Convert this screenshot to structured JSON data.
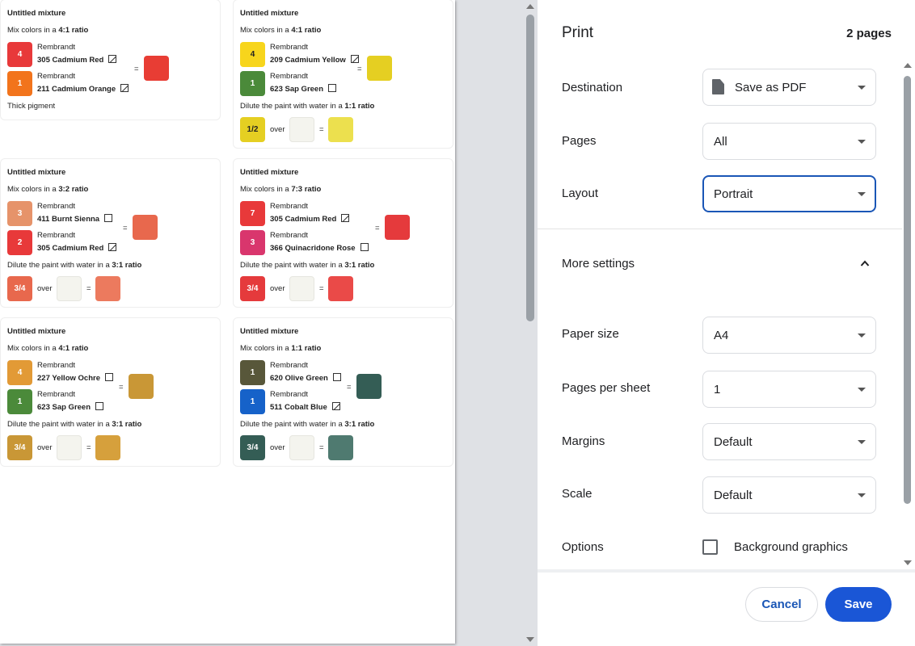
{
  "preview": {
    "cards": [
      {
        "title": "Untitled mixture",
        "mix_prefix": "Mix colors in a ",
        "ratio": "4:1 ratio",
        "paints": [
          {
            "count": "4",
            "brand": "Rembrandt",
            "name": "305 Cadmium Red",
            "color": "#e8393a",
            "flag": "half"
          },
          {
            "count": "1",
            "brand": "Rembrandt",
            "name": "211 Cadmium Orange",
            "color": "#f2741c",
            "flag": "half"
          }
        ],
        "equals": "=",
        "result_color": "#e83d34",
        "note": "Thick pigment"
      },
      {
        "title": "Untitled mixture",
        "mix_prefix": "Mix colors in a ",
        "ratio": "4:1 ratio",
        "paints": [
          {
            "count": "4",
            "brand": "Rembrandt",
            "name": "209 Cadmium Yellow",
            "color": "#f7d51c",
            "flag": "half",
            "dark": true
          },
          {
            "count": "1",
            "brand": "Rembrandt",
            "name": "623 Sap Green",
            "color": "#4b8a3a",
            "flag": "empty"
          }
        ],
        "equals": "=",
        "result_color": "#e5cf22",
        "dilute_prefix": "Dilute the paint with water in a ",
        "dilute_ratio": "1:1 ratio",
        "fraction": "1/2",
        "fraction_color": "#e5cf22",
        "over": "over",
        "diluted_color": "#ece04e"
      },
      {
        "title": "Untitled mixture",
        "mix_prefix": "Mix colors in a ",
        "ratio": "3:2 ratio",
        "paints": [
          {
            "count": "3",
            "brand": "Rembrandt",
            "name": "411 Burnt Sienna",
            "color": "#e6936a",
            "flag": "empty"
          },
          {
            "count": "2",
            "brand": "Rembrandt",
            "name": "305 Cadmium Red",
            "color": "#e8393a",
            "flag": "half"
          }
        ],
        "equals": "=",
        "result_color": "#e8684d",
        "dilute_prefix": "Dilute the paint with water in a ",
        "dilute_ratio": "3:1 ratio",
        "fraction": "3/4",
        "fraction_color": "#e8684d",
        "over": "over",
        "diluted_color": "#ec7a5e"
      },
      {
        "title": "Untitled mixture",
        "mix_prefix": "Mix colors in a ",
        "ratio": "7:3 ratio",
        "paints": [
          {
            "count": "7",
            "brand": "Rembrandt",
            "name": "305 Cadmium Red",
            "color": "#e8393a",
            "flag": "half"
          },
          {
            "count": "3",
            "brand": "Rembrandt",
            "name": "366 Quinacridone Rose",
            "color": "#d9366d",
            "flag": "empty"
          }
        ],
        "equals": "=",
        "result_color": "#e53a3c",
        "dilute_prefix": "Dilute the paint with water in a ",
        "dilute_ratio": "3:1 ratio",
        "fraction": "3/4",
        "fraction_color": "#e53a3c",
        "over": "over",
        "diluted_color": "#ea4a48"
      },
      {
        "title": "Untitled mixture",
        "mix_prefix": "Mix colors in a ",
        "ratio": "4:1 ratio",
        "paints": [
          {
            "count": "4",
            "brand": "Rembrandt",
            "name": "227 Yellow Ochre",
            "color": "#e29a36",
            "flag": "empty"
          },
          {
            "count": "1",
            "brand": "Rembrandt",
            "name": "623 Sap Green",
            "color": "#4b8a3a",
            "flag": "empty"
          }
        ],
        "equals": "=",
        "result_color": "#c99736",
        "dilute_prefix": "Dilute the paint with water in a ",
        "dilute_ratio": "3:1 ratio",
        "fraction": "3/4",
        "fraction_color": "#c99736",
        "over": "over",
        "diluted_color": "#d6a03c"
      },
      {
        "title": "Untitled mixture",
        "mix_prefix": "Mix colors in a ",
        "ratio": "1:1 ratio",
        "paints": [
          {
            "count": "1",
            "brand": "Rembrandt",
            "name": "620 Olive Green",
            "color": "#58573a",
            "flag": "empty"
          },
          {
            "count": "1",
            "brand": "Rembrandt",
            "name": "511 Cobalt Blue",
            "color": "#1662c9",
            "flag": "half"
          }
        ],
        "equals": "=",
        "result_color": "#345d55",
        "dilute_prefix": "Dilute the paint with water in a ",
        "dilute_ratio": "3:1 ratio",
        "fraction": "3/4",
        "fraction_color": "#345d55",
        "over": "over",
        "diluted_color": "#4f7a70"
      }
    ]
  },
  "dialog": {
    "title": "Print",
    "page_count": "2 pages",
    "destination": {
      "label": "Destination",
      "value": "Save as PDF"
    },
    "pages": {
      "label": "Pages",
      "value": "All"
    },
    "layout": {
      "label": "Layout",
      "value": "Portrait"
    },
    "more_settings": "More settings",
    "paper_size": {
      "label": "Paper size",
      "value": "A4"
    },
    "pages_per_sheet": {
      "label": "Pages per sheet",
      "value": "1"
    },
    "margins": {
      "label": "Margins",
      "value": "Default"
    },
    "scale": {
      "label": "Scale",
      "value": "Default"
    },
    "options": {
      "label": "Options",
      "checkbox_label": "Background graphics",
      "checked": false
    },
    "cancel_label": "Cancel",
    "save_label": "Save"
  },
  "colors": {
    "accent": "#1a56d6",
    "focus_border": "#1a56b6"
  }
}
